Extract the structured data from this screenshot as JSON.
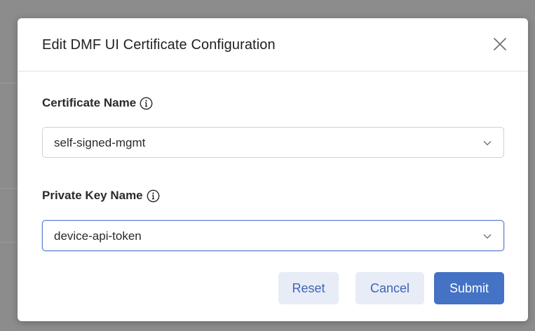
{
  "modal": {
    "title": "Edit DMF UI Certificate Configuration"
  },
  "fields": {
    "certificate": {
      "label": "Certificate Name",
      "value": "self-signed-mgmt"
    },
    "private_key": {
      "label": "Private Key Name",
      "value": "device-api-token"
    }
  },
  "actions": {
    "reset": "Reset",
    "cancel": "Cancel",
    "submit": "Submit"
  },
  "icons": {
    "close": "close-icon",
    "info": "info-icon",
    "chevron": "chevron-down-icon"
  },
  "colors": {
    "primary": "#4472c4",
    "secondary_bg": "#e7ecf6",
    "focus_border": "#5b7fd0"
  }
}
